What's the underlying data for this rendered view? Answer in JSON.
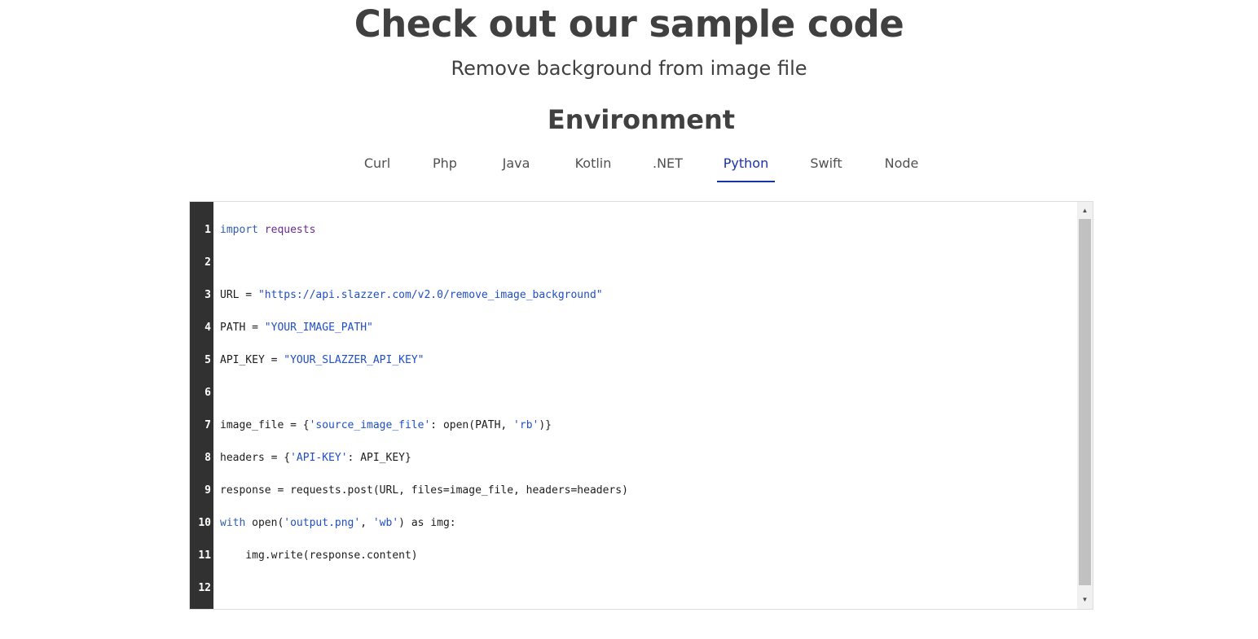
{
  "header": {
    "title": "Check out our sample code",
    "subtitle": "Remove background from image file",
    "environment_heading": "Environment"
  },
  "tabs": [
    {
      "label": "Curl",
      "active": false
    },
    {
      "label": "Php",
      "active": false
    },
    {
      "label": "Java",
      "active": false
    },
    {
      "label": "Kotlin",
      "active": false
    },
    {
      "label": ".NET",
      "active": false
    },
    {
      "label": "Python",
      "active": true
    },
    {
      "label": "Swift",
      "active": false
    },
    {
      "label": "Node",
      "active": false
    }
  ],
  "code": {
    "language": "Python",
    "line_numbers": [
      "1",
      "2",
      "3",
      "4",
      "5",
      "6",
      "7",
      "8",
      "9",
      "10",
      "11",
      "12"
    ],
    "lines": [
      "import requests",
      "",
      "URL = \"https://api.slazzer.com/v2.0/remove_image_background\"",
      "PATH = \"YOUR_IMAGE_PATH\"",
      "API_KEY = \"YOUR_SLAZZER_API_KEY\"",
      "",
      "image_file = {'source_image_file': open(PATH, 'rb')}",
      "headers = {'API-KEY': API_KEY}",
      "response = requests.post(URL, files=image_file, headers=headers)",
      "with open('output.png', 'wb') as img:",
      "    img.write(response.content)",
      ""
    ]
  },
  "colors": {
    "heading": "#404040",
    "active_tab": "#1a32a8",
    "gutter_bg": "#313131",
    "keyword": "#2e5ea8",
    "string": "#1f4fc2"
  },
  "icons": {
    "scroll_up": "triangle-up-icon",
    "scroll_down": "triangle-down-icon"
  }
}
